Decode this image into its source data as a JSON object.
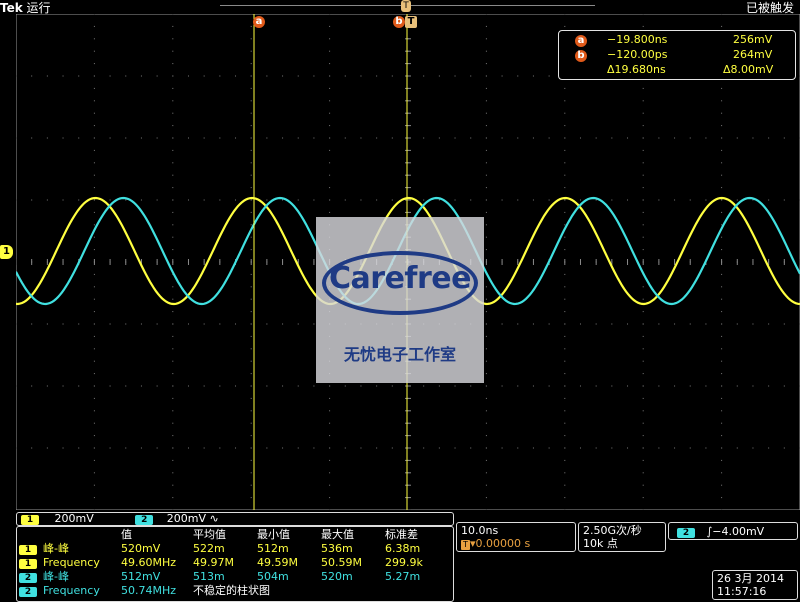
{
  "header": {
    "brand": "Tek",
    "run_state": "运行",
    "status_right": "已被触发",
    "trigger_marker": "T"
  },
  "cursors": {
    "a_label": "a",
    "b_label": "b",
    "t_label": "T"
  },
  "readout": {
    "a_icon": "a",
    "b_icon": "b",
    "a_time": "−19.800ns",
    "a_volt": "256mV",
    "b_time": "−120.00ps",
    "b_volt": "264mV",
    "delta_time": "Δ19.680ns",
    "delta_volt": "Δ8.00mV"
  },
  "watermark": {
    "brand": "Carefree",
    "subtitle": "无忧电子工作室"
  },
  "channel_marker": "1",
  "colors": {
    "ch1": "#ffff40",
    "ch2": "#40e0e0",
    "cursor_badge": "#e05a1a"
  },
  "channels": {
    "ch1_num": "1",
    "ch1_scale": "200mV",
    "ch2_num": "2",
    "ch2_scale": "200mV",
    "ch2_coupling": "∿"
  },
  "measurements": {
    "headers": [
      "值",
      "平均值",
      "最小值",
      "最大值",
      "标准差"
    ],
    "rows": [
      {
        "ch": "1",
        "name": "峰-峰",
        "value": "520mV",
        "mean": "522m",
        "min": "512m",
        "max": "536m",
        "std": "6.38m"
      },
      {
        "ch": "1",
        "name": "Frequency",
        "value": "49.60MHz",
        "mean": "49.97M",
        "min": "49.59M",
        "max": "50.59M",
        "std": "299.9k"
      },
      {
        "ch": "2",
        "name": "峰-峰",
        "value": "512mV",
        "mean": "513m",
        "min": "504m",
        "max": "520m",
        "std": "5.27m"
      },
      {
        "ch": "2",
        "name": "Frequency",
        "value": "50.74MHz",
        "note": "不稳定的柱状图"
      }
    ]
  },
  "timebase": {
    "scale": "10.0ns",
    "trigger_icon": "T",
    "position": "▾0.00000 s"
  },
  "acquisition": {
    "rate": "2.50G次/秒",
    "points": "10k 点"
  },
  "trigger": {
    "source": "2",
    "level": "∫−4.00mV"
  },
  "datetime": {
    "date": "26 3月  2014",
    "time": "11:57:16"
  }
}
